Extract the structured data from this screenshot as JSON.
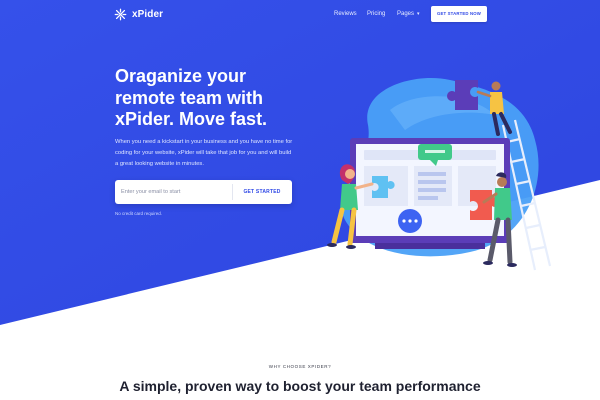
{
  "brand": {
    "name": "xPider"
  },
  "nav": {
    "links": [
      {
        "label": "Reviews"
      },
      {
        "label": "Pricing"
      },
      {
        "label": "Pages"
      }
    ],
    "cta_label": "GET STARTED NOW"
  },
  "hero": {
    "headline": "Oraganize your remote team with xPider. Move fast.",
    "subtext": "When you need a kickstart in your business and you have no time for coding for your website, xPider will take that job for you and will build a great looking website in minutes.",
    "email_placeholder": "Enter your email to start",
    "signup_button": "GET STARTED",
    "fineprint": "No credit card required."
  },
  "section": {
    "eyebrow": "WHY CHOOSE XPIDER?",
    "title": "A simple, proven way to boost your team performance"
  },
  "colors": {
    "primary": "#2f48e6",
    "primary_light": "#3d63f2",
    "blob": "#4aa0f7",
    "accent_green": "#41c98a",
    "accent_red": "#f15b4f",
    "accent_purple": "#5b3db8",
    "accent_yellow": "#f6c343"
  },
  "icons": [
    "logo-mark-icon",
    "chevron-down-icon"
  ]
}
